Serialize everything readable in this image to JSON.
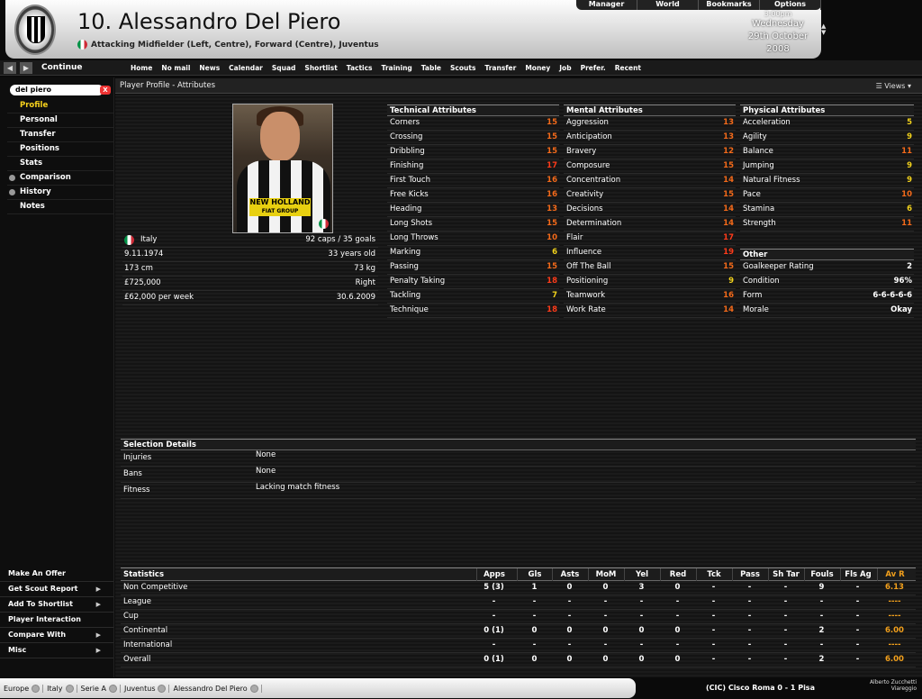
{
  "header": {
    "name": "10. Alessandro Del Piero",
    "subtitle": "Attacking Midfielder (Left, Centre), Forward (Centre), Juventus",
    "date_day": "Wednesday",
    "date_full": "29th October",
    "date_year": "2008",
    "date_top": "3:00pm"
  },
  "topmenu": [
    "Manager",
    "World",
    "Bookmarks",
    "Options"
  ],
  "nav": {
    "continue": "Continue",
    "tabs": [
      "Home",
      "No mail",
      "News",
      "Calendar",
      "Squad",
      "Shortlist",
      "Tactics",
      "Training",
      "Table",
      "Scouts",
      "Transfer",
      "Money",
      "Job",
      "Prefer.",
      "Recent"
    ]
  },
  "search": {
    "value": "del piero",
    "clear": "X"
  },
  "sidebar": {
    "items": [
      "Profile",
      "Personal",
      "Transfer",
      "Positions",
      "Stats",
      "Comparison",
      "History",
      "Notes"
    ],
    "bottom": [
      "Make An Offer",
      "Get Scout Report",
      "Add To Shortlist",
      "Player Interaction",
      "Compare With",
      "Misc"
    ]
  },
  "panel": {
    "title": "Player Profile - Attributes",
    "views": "Views"
  },
  "photo": {
    "sponsor1": "NEW HOLLAND",
    "sponsor2": "FIAT GROUP"
  },
  "info": [
    [
      "Italy",
      "92 caps / 35 goals"
    ],
    [
      "9.11.1974",
      "33 years old"
    ],
    [
      "173 cm",
      "73 kg"
    ],
    [
      "£725,000",
      "Right"
    ],
    [
      "£62,000 per week",
      "30.6.2009"
    ]
  ],
  "technical": {
    "title": "Technical Attributes",
    "rows": [
      [
        "Corners",
        "15",
        "o"
      ],
      [
        "Crossing",
        "15",
        "o"
      ],
      [
        "Dribbling",
        "15",
        "o"
      ],
      [
        "Finishing",
        "17",
        "r"
      ],
      [
        "First Touch",
        "16",
        "o"
      ],
      [
        "Free Kicks",
        "16",
        "o"
      ],
      [
        "Heading",
        "13",
        "o"
      ],
      [
        "Long Shots",
        "15",
        "o"
      ],
      [
        "Long Throws",
        "10",
        "o"
      ],
      [
        "Marking",
        "6",
        "y"
      ],
      [
        "Passing",
        "15",
        "o"
      ],
      [
        "Penalty Taking",
        "18",
        "r"
      ],
      [
        "Tackling",
        "7",
        "y"
      ],
      [
        "Technique",
        "18",
        "r"
      ]
    ]
  },
  "mental": {
    "title": "Mental Attributes",
    "rows": [
      [
        "Aggression",
        "13",
        "o"
      ],
      [
        "Anticipation",
        "13",
        "o"
      ],
      [
        "Bravery",
        "12",
        "o"
      ],
      [
        "Composure",
        "15",
        "o"
      ],
      [
        "Concentration",
        "14",
        "o"
      ],
      [
        "Creativity",
        "15",
        "o"
      ],
      [
        "Decisions",
        "14",
        "o"
      ],
      [
        "Determination",
        "14",
        "o"
      ],
      [
        "Flair",
        "17",
        "r"
      ],
      [
        "Influence",
        "19",
        "r"
      ],
      [
        "Off The Ball",
        "15",
        "o"
      ],
      [
        "Positioning",
        "9",
        "y"
      ],
      [
        "Teamwork",
        "16",
        "o"
      ],
      [
        "Work Rate",
        "14",
        "o"
      ]
    ]
  },
  "physical": {
    "title": "Physical Attributes",
    "rows": [
      [
        "Acceleration",
        "5",
        "y"
      ],
      [
        "Agility",
        "9",
        "y"
      ],
      [
        "Balance",
        "11",
        "o"
      ],
      [
        "Jumping",
        "9",
        "y"
      ],
      [
        "Natural Fitness",
        "9",
        "y"
      ],
      [
        "Pace",
        "10",
        "o"
      ],
      [
        "Stamina",
        "6",
        "y"
      ],
      [
        "Strength",
        "11",
        "o"
      ]
    ]
  },
  "other": {
    "title": "Other",
    "rows": [
      [
        "Goalkeeper Rating",
        "2",
        "w"
      ],
      [
        "Condition",
        "96%",
        "w"
      ],
      [
        "Form",
        "6-6-6-6-6",
        "w"
      ],
      [
        "Morale",
        "Okay",
        "w"
      ]
    ]
  },
  "selection": {
    "title": "Selection Details",
    "rows": [
      [
        "Injuries",
        "None"
      ],
      [
        "Bans",
        "None"
      ],
      [
        "Fitness",
        "Lacking match fitness"
      ]
    ]
  },
  "stats": {
    "headers": [
      "Statistics",
      "Apps",
      "Gls",
      "Asts",
      "MoM",
      "Yel",
      "Red",
      "Tck",
      "Pass",
      "Sh Tar",
      "Fouls",
      "Fls Ag",
      "Av R"
    ],
    "rows": [
      [
        "Non Competitive",
        "5 (3)",
        "1",
        "0",
        "0",
        "3",
        "0",
        "-",
        "-",
        "-",
        "9",
        "-",
        "6.13"
      ],
      [
        "League",
        "-",
        "-",
        "-",
        "-",
        "-",
        "-",
        "-",
        "-",
        "-",
        "-",
        "-",
        "----"
      ],
      [
        "Cup",
        "-",
        "-",
        "-",
        "-",
        "-",
        "-",
        "-",
        "-",
        "-",
        "-",
        "-",
        "----"
      ],
      [
        "Continental",
        "0 (1)",
        "0",
        "0",
        "0",
        "0",
        "0",
        "-",
        "-",
        "-",
        "2",
        "-",
        "6.00"
      ],
      [
        "International",
        "-",
        "-",
        "-",
        "-",
        "-",
        "-",
        "-",
        "-",
        "-",
        "-",
        "-",
        "----"
      ],
      [
        "Overall",
        "0 (1)",
        "0",
        "0",
        "0",
        "0",
        "0",
        "-",
        "-",
        "-",
        "2",
        "-",
        "6.00"
      ]
    ]
  },
  "status": {
    "crumbs": [
      "Europe",
      "Italy",
      "Serie A",
      "Juventus",
      "Alessandro Del Piero"
    ],
    "score": "(CIC) Cisco Roma 0 - 1 Pisa",
    "manager": "Alberto Zucchetti Viareggio"
  },
  "colors": {
    "orange": "#f46a1a",
    "red": "#ff3b1a",
    "yellow": "#f2d21c",
    "selected": "#f7d21c"
  }
}
